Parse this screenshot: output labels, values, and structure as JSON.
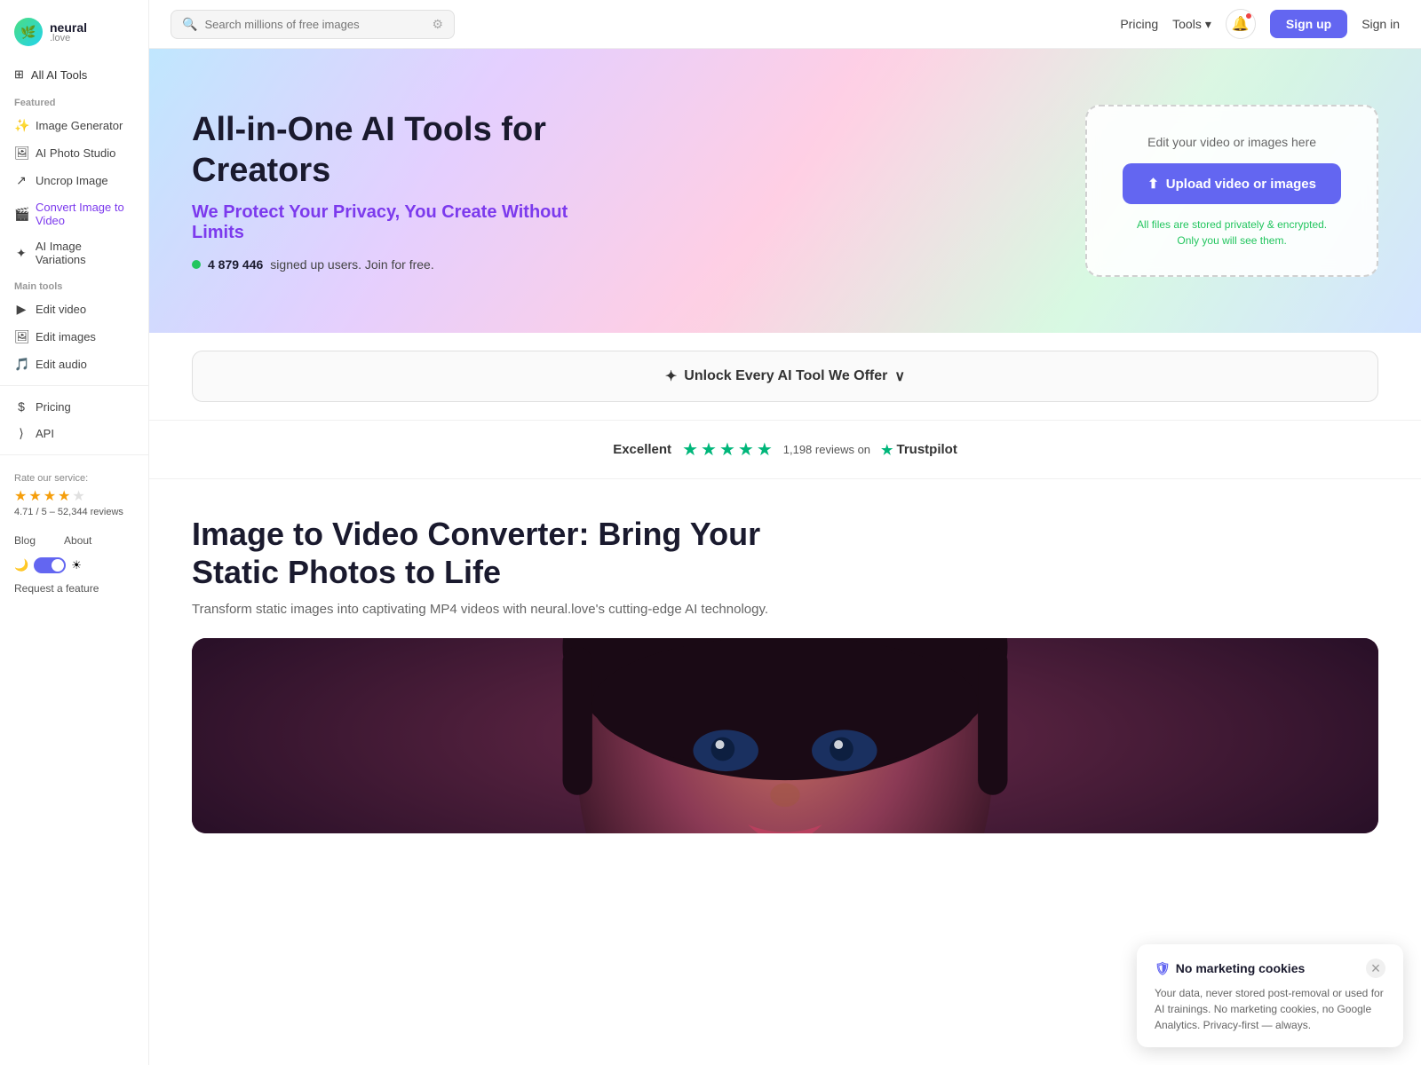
{
  "app": {
    "name": "neural",
    "sub": ".love",
    "logoEmoji": "🌿"
  },
  "header": {
    "search_placeholder": "Search millions of free images",
    "pricing_label": "Pricing",
    "tools_label": "Tools",
    "tools_arrow": "▾",
    "signup_label": "Sign up",
    "signin_label": "Sign in"
  },
  "sidebar": {
    "all_tools_label": "All AI Tools",
    "featured_label": "Featured",
    "items_featured": [
      {
        "icon": "✨",
        "label": "Image Generator"
      },
      {
        "icon": "🖼",
        "label": "AI Photo Studio"
      },
      {
        "icon": "↗",
        "label": "Uncrop Image"
      },
      {
        "icon": "🎬",
        "label": "Convert Image to Video"
      },
      {
        "icon": "✦",
        "label": "AI Image Variations"
      }
    ],
    "main_tools_label": "Main tools",
    "items_main": [
      {
        "icon": "▶",
        "label": "Edit video"
      },
      {
        "icon": "🖼",
        "label": "Edit images"
      },
      {
        "icon": "🎵",
        "label": "Edit audio"
      }
    ],
    "pricing_label": "Pricing",
    "api_label": "API",
    "rate_label": "Rate our service:",
    "stars": [
      "★",
      "★",
      "★",
      "★",
      "☆"
    ],
    "rate_score": "4.71 / 5 – 52,344 reviews",
    "blog_label": "Blog",
    "about_label": "About",
    "request_label": "Request a feature"
  },
  "hero": {
    "title": "All-in-One AI Tools for Creators",
    "subtitle": "We Protect Your Privacy, You Create Without Limits",
    "users_count": "4 879 446",
    "users_text": "signed up users. Join for free.",
    "upload_label": "Edit your video or images here",
    "upload_btn": "Upload video or images",
    "upload_upload_icon": "↑",
    "secure_line1": "All files are stored privately & encrypted.",
    "secure_line2": "Only you will see them."
  },
  "unlock": {
    "icon": "✦",
    "label": "Unlock Every AI Tool We Offer",
    "arrow": "∨"
  },
  "trustpilot": {
    "excellent_label": "Excellent",
    "reviews_text": "1,198 reviews on",
    "trustpilot_label": "Trustpilot"
  },
  "section": {
    "title": "Image to Video Converter: Bring Your Static Photos to Life",
    "subtitle": "Transform static images into captivating MP4 videos with neural.love's cutting-edge AI technology."
  },
  "cookie": {
    "title": "No marketing cookies",
    "icon": "🛡",
    "text": "Your data, never stored post-removal or used for AI trainings. No marketing cookies, no Google Analytics. Privacy-first — always."
  }
}
